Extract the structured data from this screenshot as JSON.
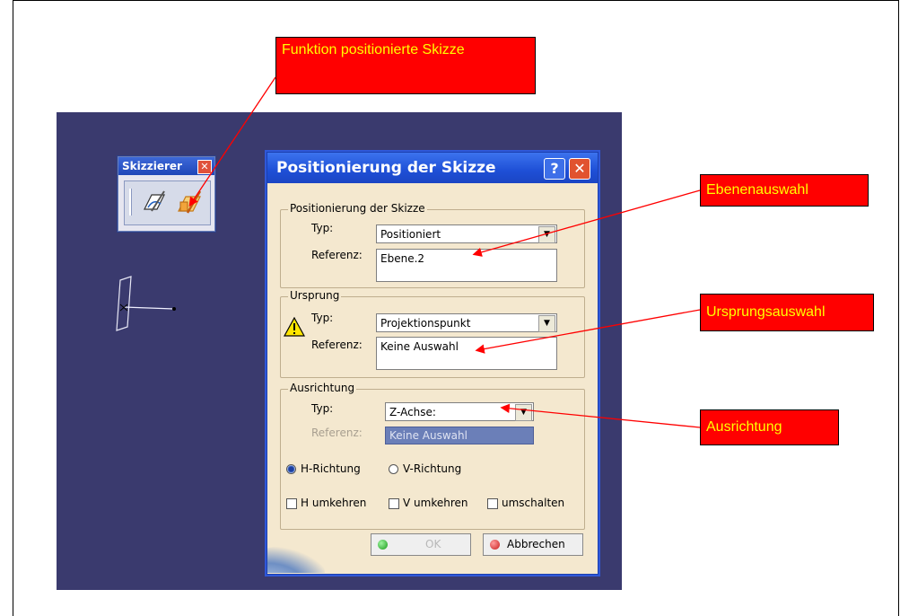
{
  "callouts": {
    "funktion": "Funktion positionierte Skizze",
    "ebene": "Ebenenauswahl",
    "ursprung": "Ursprungsauswahl",
    "ausrichtung": "Ausrichtung"
  },
  "toolbar": {
    "title": "Skizzierer",
    "close": "✕"
  },
  "dialog": {
    "title": "Positionierung der Skizze",
    "help": "?",
    "close": "✕",
    "groups": {
      "positionierung": {
        "label": "Positionierung der Skizze",
        "typ_label": "Typ:",
        "typ_value": "Positioniert",
        "referenz_label": "Referenz:",
        "referenz_value": "Ebene.2"
      },
      "ursprung": {
        "label": "Ursprung",
        "typ_label": "Typ:",
        "typ_value": "Projektionspunkt",
        "referenz_label": "Referenz:",
        "referenz_value": "Keine Auswahl"
      },
      "ausrichtung": {
        "label": "Ausrichtung",
        "typ_label": "Typ:",
        "typ_value": "Z-Achse:",
        "referenz_label": "Referenz:",
        "referenz_value": "Keine Auswahl"
      }
    },
    "radios": {
      "h": "H-Richtung",
      "v": "V-Richtung",
      "selected": "h"
    },
    "checkboxes": {
      "h_umkehren": "H umkehren",
      "v_umkehren": "V umkehren",
      "umschalten": "umschalten"
    },
    "buttons": {
      "ok": "OK",
      "cancel": "Abbrechen"
    }
  },
  "colors": {
    "viewport": "#3a3a6e",
    "callout_bg": "#ff0000",
    "callout_text": "#ffff00",
    "dialog_bg": "#f4e8cf"
  }
}
